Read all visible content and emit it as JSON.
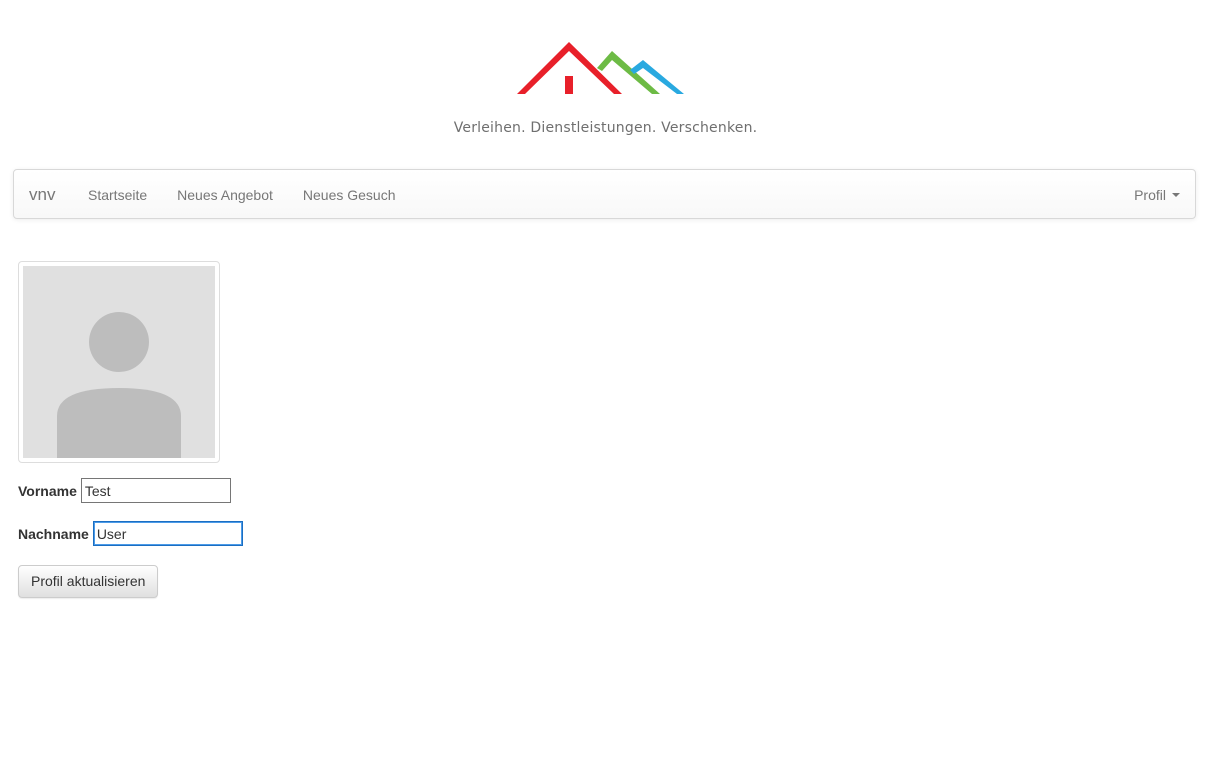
{
  "header": {
    "tagline": "Verleihen. Dienstleistungen. Verschenken.",
    "logo_colors": [
      "#e8202a",
      "#6dbb45",
      "#29a9e0"
    ]
  },
  "navbar": {
    "brand": "vnv",
    "items": [
      {
        "label": "Startseite"
      },
      {
        "label": "Neues Angebot"
      },
      {
        "label": "Neues Gesuch"
      }
    ],
    "profile_menu": "Profil"
  },
  "profile": {
    "avatar_icon": "user-placeholder-icon",
    "vorname_label": "Vorname",
    "vorname_value": "Test",
    "nachname_label": "Nachname",
    "nachname_value": "User",
    "submit_label": "Profil aktualisieren"
  }
}
